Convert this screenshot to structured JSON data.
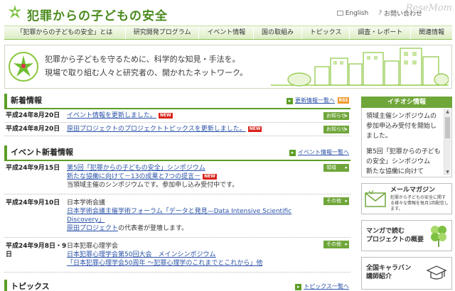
{
  "header": {
    "title": "犯罪からの子どもの安全",
    "links": {
      "english": "English",
      "inquiry": "お問い合わせ"
    },
    "watermark": "ReseMom"
  },
  "nav": {
    "items": [
      "「犯罪からの子どもの安全」とは",
      "研究開発プログラム",
      "イベント情報",
      "国の取組み",
      "トピックス",
      "調査・レポート",
      "関連情報"
    ]
  },
  "hero": {
    "line1": "犯罪から子どもを守るために、科学的な知見・手法を。",
    "line2": "現場で取り組む人々と研究者の、開かれたネットワーク。"
  },
  "news": {
    "title": "新着情報",
    "more": "更新情報一覧へ",
    "rss": "RSS",
    "items": [
      {
        "date": "平成24年8月20日",
        "text": "イベント情報を更新しました。",
        "new": "NEW",
        "tag": "お知らせ"
      },
      {
        "date": "平成24年8月20日",
        "text": "原田プロジェクトのプロジェクトトピックスを更新しました。",
        "new": "NEW",
        "tag": "お知らせ"
      }
    ]
  },
  "events": {
    "title": "イベント新着情報",
    "more": "イベント情報一覧へ",
    "items": [
      {
        "date": "平成24年9月15日",
        "link1": "第5回「犯罪からの子どもの安全」シンポジウム",
        "link2": "新たな協働に向けて－13の成果と7つの提言－",
        "new": "NEW",
        "desc": "当領域主催のシンポジウムです。参加申し込み受付中です。",
        "tag": "領域"
      },
      {
        "date": "平成24年9月10日",
        "org": "日本学術会議",
        "link1": "日本学術会議主催学術フォーラム「データと発見—Data Intensive Scientific",
        "link2": "Discovery」",
        "link3": "原田プロジェクト",
        "desc": "の代表者が登壇します。",
        "tag": "その他"
      },
      {
        "date": "平成24年9月8日・9日",
        "org": "日本犯罪心理学会",
        "link1": "日本犯罪心理学会第50回大会　メインシンポジウム",
        "link2": "「日本犯罪心理学会50周年 ～犯罪心理学のこれまでとこれから」他",
        "tag": "その他"
      }
    ]
  },
  "topics": {
    "title": "トピックス",
    "more": "トピックス一覧へ"
  },
  "sidebar": {
    "title": "イチオシ情報",
    "p1": "領域主催シンポジウムの参加申込み受付を開始しました。",
    "p2": "第5回「犯罪からの子どもの安全」シンポジウム　新たな協働に向けて",
    "banners": {
      "mail": {
        "title": "メールマガジン",
        "sub": "犯罪から子どもの安全に関する様々な情報を毎月1回配信します。"
      },
      "manga": {
        "title": "マンガで読む",
        "title2": "プロジェクトの概要"
      },
      "caravan": {
        "title": "全国キャラバン",
        "title2": "講師紹介"
      }
    }
  },
  "colors": {
    "accent": "#5c9e27",
    "tag": "#6fa63a",
    "new": "#d9231c",
    "link": "#2a52a8"
  }
}
